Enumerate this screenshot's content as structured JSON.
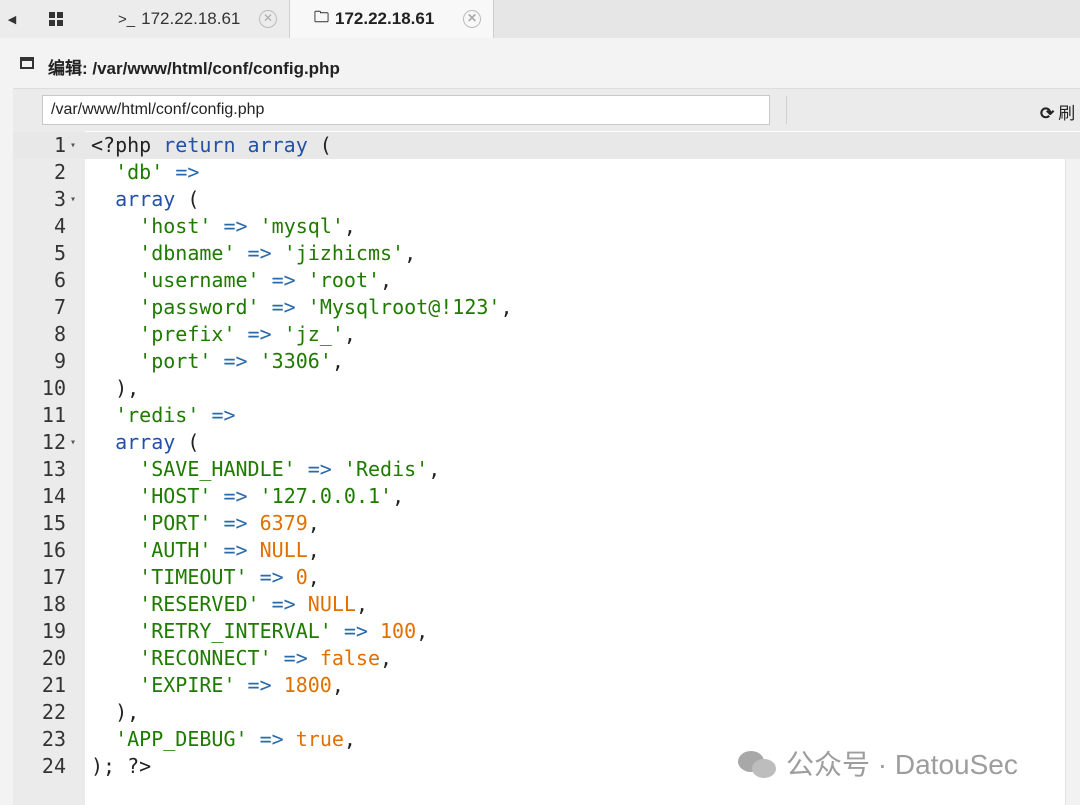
{
  "tabs": {
    "items": [
      {
        "glyph": ">_",
        "label": "172.22.18.61",
        "close": "✕"
      },
      {
        "glyph": "🗀",
        "label": "172.22.18.61",
        "close": "✕"
      }
    ]
  },
  "header": {
    "title": "编辑: /var/www/html/conf/config.php"
  },
  "path": {
    "value": "/var/www/html/conf/config.php"
  },
  "refresh": {
    "icon": "⟳",
    "label": "刷"
  },
  "editor": {
    "active_line": 1,
    "lines": [
      {
        "n": "1",
        "fold": true,
        "tokens": [
          [
            "plain",
            "<?php "
          ],
          [
            "keyword",
            "return"
          ],
          [
            "plain",
            " "
          ],
          [
            "keyword",
            "array"
          ],
          [
            "plain",
            " ("
          ]
        ]
      },
      {
        "n": "2",
        "fold": false,
        "tokens": [
          [
            "plain",
            "  "
          ],
          [
            "string",
            "'db'"
          ],
          [
            "plain",
            " "
          ],
          [
            "op",
            "=>"
          ]
        ]
      },
      {
        "n": "3",
        "fold": true,
        "tokens": [
          [
            "plain",
            "  "
          ],
          [
            "keyword",
            "array"
          ],
          [
            "plain",
            " ("
          ]
        ]
      },
      {
        "n": "4",
        "fold": false,
        "tokens": [
          [
            "plain",
            "    "
          ],
          [
            "string",
            "'host'"
          ],
          [
            "plain",
            " "
          ],
          [
            "op",
            "=>"
          ],
          [
            "plain",
            " "
          ],
          [
            "string",
            "'mysql'"
          ],
          [
            "plain",
            ","
          ]
        ]
      },
      {
        "n": "5",
        "fold": false,
        "tokens": [
          [
            "plain",
            "    "
          ],
          [
            "string",
            "'dbname'"
          ],
          [
            "plain",
            " "
          ],
          [
            "op",
            "=>"
          ],
          [
            "plain",
            " "
          ],
          [
            "string",
            "'jizhicms'"
          ],
          [
            "plain",
            ","
          ]
        ]
      },
      {
        "n": "6",
        "fold": false,
        "tokens": [
          [
            "plain",
            "    "
          ],
          [
            "string",
            "'username'"
          ],
          [
            "plain",
            " "
          ],
          [
            "op",
            "=>"
          ],
          [
            "plain",
            " "
          ],
          [
            "string",
            "'root'"
          ],
          [
            "plain",
            ","
          ]
        ]
      },
      {
        "n": "7",
        "fold": false,
        "tokens": [
          [
            "plain",
            "    "
          ],
          [
            "string",
            "'password'"
          ],
          [
            "plain",
            " "
          ],
          [
            "op",
            "=>"
          ],
          [
            "plain",
            " "
          ],
          [
            "string",
            "'Mysqlroot@!123'"
          ],
          [
            "plain",
            ","
          ]
        ]
      },
      {
        "n": "8",
        "fold": false,
        "tokens": [
          [
            "plain",
            "    "
          ],
          [
            "string",
            "'prefix'"
          ],
          [
            "plain",
            " "
          ],
          [
            "op",
            "=>"
          ],
          [
            "plain",
            " "
          ],
          [
            "string",
            "'jz_'"
          ],
          [
            "plain",
            ","
          ]
        ]
      },
      {
        "n": "9",
        "fold": false,
        "tokens": [
          [
            "plain",
            "    "
          ],
          [
            "string",
            "'port'"
          ],
          [
            "plain",
            " "
          ],
          [
            "op",
            "=>"
          ],
          [
            "plain",
            " "
          ],
          [
            "string",
            "'3306'"
          ],
          [
            "plain",
            ","
          ]
        ]
      },
      {
        "n": "10",
        "fold": false,
        "tokens": [
          [
            "plain",
            "  ),"
          ]
        ]
      },
      {
        "n": "11",
        "fold": false,
        "tokens": [
          [
            "plain",
            "  "
          ],
          [
            "string",
            "'redis'"
          ],
          [
            "plain",
            " "
          ],
          [
            "op",
            "=>"
          ]
        ]
      },
      {
        "n": "12",
        "fold": true,
        "tokens": [
          [
            "plain",
            "  "
          ],
          [
            "keyword",
            "array"
          ],
          [
            "plain",
            " ("
          ]
        ]
      },
      {
        "n": "13",
        "fold": false,
        "tokens": [
          [
            "plain",
            "    "
          ],
          [
            "string",
            "'SAVE_HANDLE'"
          ],
          [
            "plain",
            " "
          ],
          [
            "op",
            "=>"
          ],
          [
            "plain",
            " "
          ],
          [
            "string",
            "'Redis'"
          ],
          [
            "plain",
            ","
          ]
        ]
      },
      {
        "n": "14",
        "fold": false,
        "tokens": [
          [
            "plain",
            "    "
          ],
          [
            "string",
            "'HOST'"
          ],
          [
            "plain",
            " "
          ],
          [
            "op",
            "=>"
          ],
          [
            "plain",
            " "
          ],
          [
            "string",
            "'127.0.0.1'"
          ],
          [
            "plain",
            ","
          ]
        ]
      },
      {
        "n": "15",
        "fold": false,
        "tokens": [
          [
            "plain",
            "    "
          ],
          [
            "string",
            "'PORT'"
          ],
          [
            "plain",
            " "
          ],
          [
            "op",
            "=>"
          ],
          [
            "plain",
            " "
          ],
          [
            "number",
            "6379"
          ],
          [
            "plain",
            ","
          ]
        ]
      },
      {
        "n": "16",
        "fold": false,
        "tokens": [
          [
            "plain",
            "    "
          ],
          [
            "string",
            "'AUTH'"
          ],
          [
            "plain",
            " "
          ],
          [
            "op",
            "=>"
          ],
          [
            "plain",
            " "
          ],
          [
            "constant",
            "NULL"
          ],
          [
            "plain",
            ","
          ]
        ]
      },
      {
        "n": "17",
        "fold": false,
        "tokens": [
          [
            "plain",
            "    "
          ],
          [
            "string",
            "'TIMEOUT'"
          ],
          [
            "plain",
            " "
          ],
          [
            "op",
            "=>"
          ],
          [
            "plain",
            " "
          ],
          [
            "number",
            "0"
          ],
          [
            "plain",
            ","
          ]
        ]
      },
      {
        "n": "18",
        "fold": false,
        "tokens": [
          [
            "plain",
            "    "
          ],
          [
            "string",
            "'RESERVED'"
          ],
          [
            "plain",
            " "
          ],
          [
            "op",
            "=>"
          ],
          [
            "plain",
            " "
          ],
          [
            "constant",
            "NULL"
          ],
          [
            "plain",
            ","
          ]
        ]
      },
      {
        "n": "19",
        "fold": false,
        "tokens": [
          [
            "plain",
            "    "
          ],
          [
            "string",
            "'RETRY_INTERVAL'"
          ],
          [
            "plain",
            " "
          ],
          [
            "op",
            "=>"
          ],
          [
            "plain",
            " "
          ],
          [
            "number",
            "100"
          ],
          [
            "plain",
            ","
          ]
        ]
      },
      {
        "n": "20",
        "fold": false,
        "tokens": [
          [
            "plain",
            "    "
          ],
          [
            "string",
            "'RECONNECT'"
          ],
          [
            "plain",
            " "
          ],
          [
            "op",
            "=>"
          ],
          [
            "plain",
            " "
          ],
          [
            "constant",
            "false"
          ],
          [
            "plain",
            ","
          ]
        ]
      },
      {
        "n": "21",
        "fold": false,
        "tokens": [
          [
            "plain",
            "    "
          ],
          [
            "string",
            "'EXPIRE'"
          ],
          [
            "plain",
            " "
          ],
          [
            "op",
            "=>"
          ],
          [
            "plain",
            " "
          ],
          [
            "number",
            "1800"
          ],
          [
            "plain",
            ","
          ]
        ]
      },
      {
        "n": "22",
        "fold": false,
        "tokens": [
          [
            "plain",
            "  ),"
          ]
        ]
      },
      {
        "n": "23",
        "fold": false,
        "tokens": [
          [
            "plain",
            "  "
          ],
          [
            "string",
            "'APP_DEBUG'"
          ],
          [
            "plain",
            " "
          ],
          [
            "op",
            "=>"
          ],
          [
            "plain",
            " "
          ],
          [
            "constant",
            "true"
          ],
          [
            "plain",
            ","
          ]
        ]
      },
      {
        "n": "24",
        "fold": false,
        "tokens": [
          [
            "plain",
            "); ?>"
          ]
        ]
      }
    ]
  },
  "watermark": {
    "text": "公众号 · DatouSec"
  }
}
